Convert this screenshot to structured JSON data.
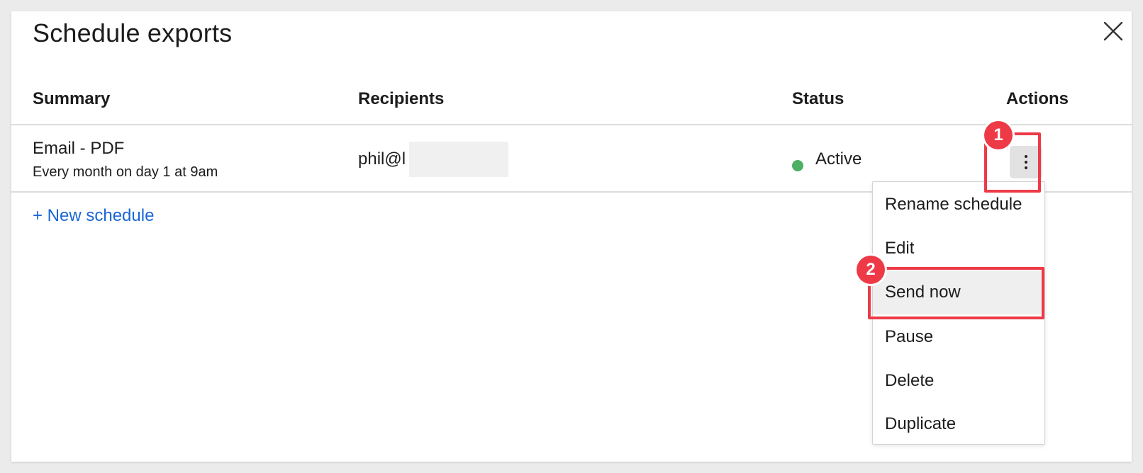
{
  "dialog": {
    "title": "Schedule exports",
    "close_icon": "close-icon"
  },
  "table": {
    "headers": {
      "summary": "Summary",
      "recipients": "Recipients",
      "status": "Status",
      "actions": "Actions"
    },
    "rows": [
      {
        "summary": "Email - PDF",
        "frequency": "Every month on day 1 at 9am",
        "recipient": "phil@l",
        "status": "Active",
        "status_color": "#4caf63",
        "actions_icon": "more-vertical-icon"
      }
    ]
  },
  "new_schedule_label": "+ New schedule",
  "actions_menu": {
    "items": [
      {
        "label": "Rename schedule"
      },
      {
        "label": "Edit"
      },
      {
        "label": "Send now"
      },
      {
        "label": "Pause"
      },
      {
        "label": "Delete"
      },
      {
        "label": "Duplicate"
      }
    ],
    "hovered_item": "Send now"
  },
  "annotations": {
    "step_1": "1",
    "step_2": "2",
    "highlight_color": "#ee3a47"
  },
  "colors": {
    "link": "#1a66d6",
    "background": "#ebebeb",
    "menu_hover": "#efefef"
  }
}
